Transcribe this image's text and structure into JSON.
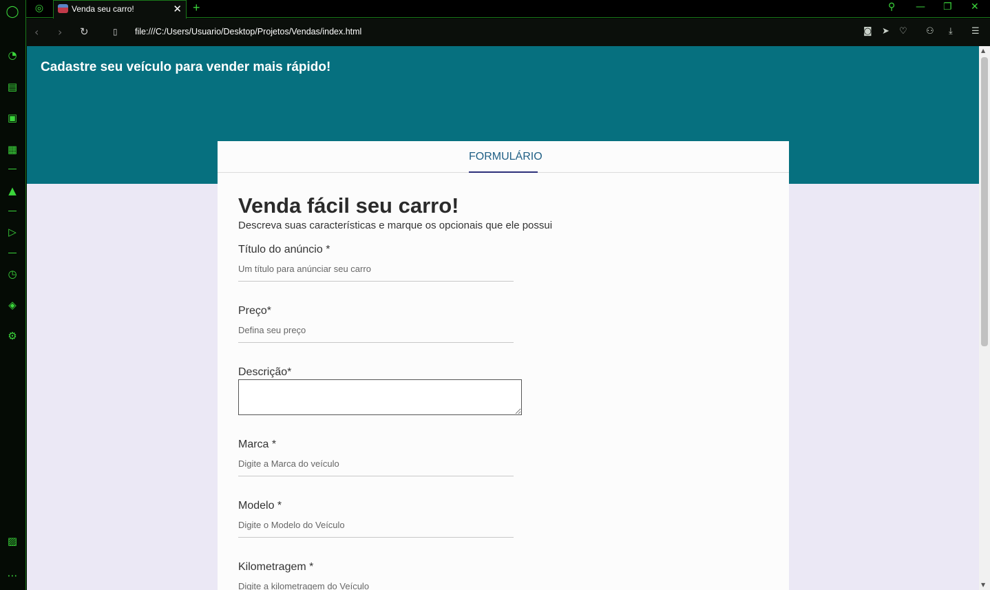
{
  "browser": {
    "tab_title": "Venda seu carro!",
    "url": "file:///C:/Users/Usuario/Desktop/Projetos/Vendas/index.html",
    "accent_color": "#3bd63b"
  },
  "page": {
    "hero_title": "Cadastre seu veículo para vender mais rápido!",
    "card_tab": "FORMULÁRIO",
    "form_title": "Venda fácil seu carro!",
    "form_subtitle": "Descreva suas características e marque os opcionais que ele possui",
    "fields": {
      "titulo": {
        "label": "Título do anúncio *",
        "placeholder": "Um título para anúnciar seu carro"
      },
      "preco": {
        "label": "Preço*",
        "placeholder": "Defina seu preço"
      },
      "descricao": {
        "label": "Descrição*"
      },
      "marca": {
        "label": "Marca *",
        "placeholder": "Digite a Marca do veículo"
      },
      "modelo": {
        "label": "Modelo *",
        "placeholder": "Digite o Modelo do Veículo"
      },
      "km": {
        "label": "Kilometragem *",
        "placeholder": "Digite a kilometragem do Veículo"
      }
    },
    "hero_color": "#06707f",
    "background_color": "#ebe8f5"
  }
}
